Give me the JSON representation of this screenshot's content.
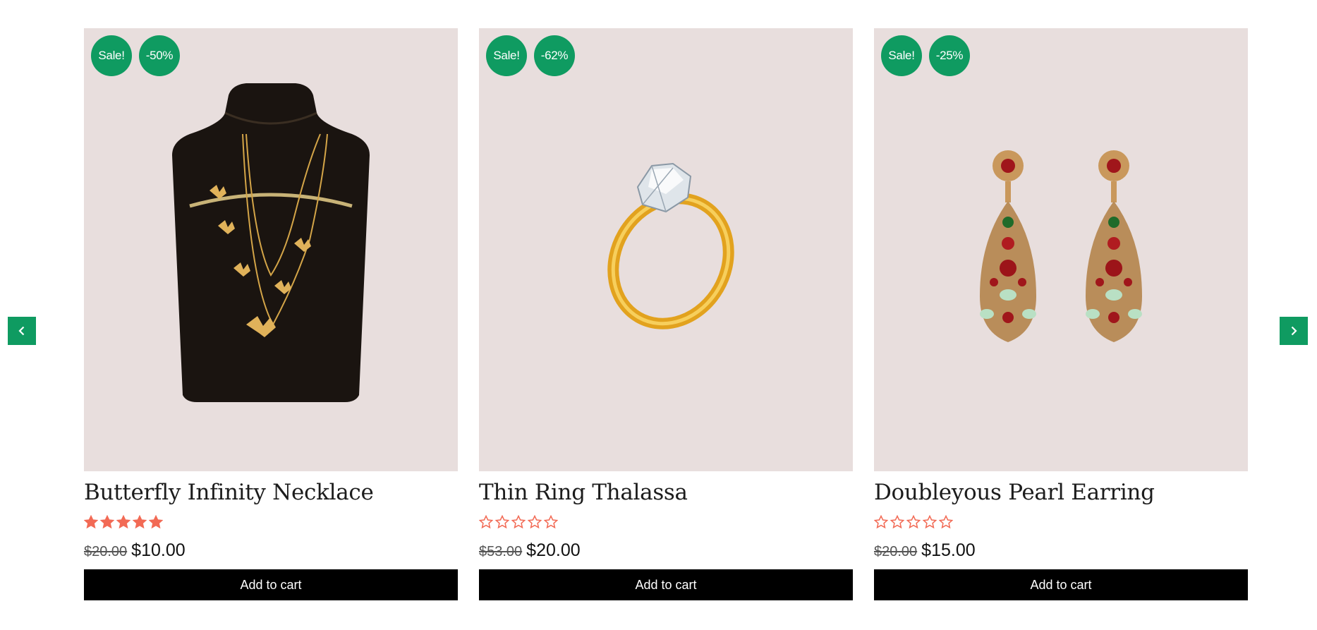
{
  "carousel": {
    "prev_icon": "chevron-left-icon",
    "next_icon": "chevron-right-icon",
    "accent_color": "#0f9b61",
    "star_color": "#f26a55",
    "card_background": "#e8dedd"
  },
  "products": [
    {
      "badge_sale": "Sale!",
      "badge_discount": "-50%",
      "title": "Butterfly Infinity Necklace",
      "rating": 5,
      "old_price": "$20.00",
      "new_price": "$10.00",
      "button_label": "Add to cart"
    },
    {
      "badge_sale": "Sale!",
      "badge_discount": "-62%",
      "title": "Thin Ring Thalassa",
      "rating": 0,
      "old_price": "$53.00",
      "new_price": "$20.00",
      "button_label": "Add to cart"
    },
    {
      "badge_sale": "Sale!",
      "badge_discount": "-25%",
      "title": "Doubleyous Pearl Earring",
      "rating": 0,
      "old_price": "$20.00",
      "new_price": "$15.00",
      "button_label": "Add to cart"
    }
  ]
}
